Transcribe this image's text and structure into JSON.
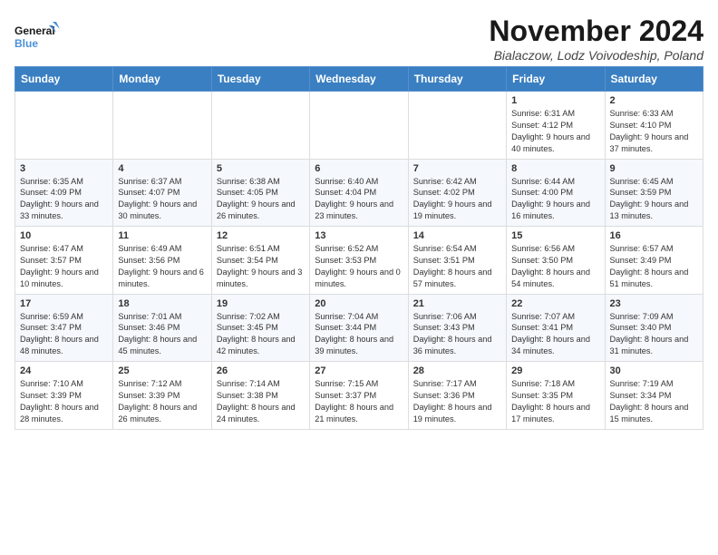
{
  "logo": {
    "line1": "General",
    "line2": "Blue"
  },
  "title": "November 2024",
  "subtitle": "Bialaczow, Lodz Voivodeship, Poland",
  "weekdays": [
    "Sunday",
    "Monday",
    "Tuesday",
    "Wednesday",
    "Thursday",
    "Friday",
    "Saturday"
  ],
  "weeks": [
    [
      {
        "day": "",
        "sunrise": "",
        "sunset": "",
        "daylight": ""
      },
      {
        "day": "",
        "sunrise": "",
        "sunset": "",
        "daylight": ""
      },
      {
        "day": "",
        "sunrise": "",
        "sunset": "",
        "daylight": ""
      },
      {
        "day": "",
        "sunrise": "",
        "sunset": "",
        "daylight": ""
      },
      {
        "day": "",
        "sunrise": "",
        "sunset": "",
        "daylight": ""
      },
      {
        "day": "1",
        "sunrise": "Sunrise: 6:31 AM",
        "sunset": "Sunset: 4:12 PM",
        "daylight": "Daylight: 9 hours and 40 minutes."
      },
      {
        "day": "2",
        "sunrise": "Sunrise: 6:33 AM",
        "sunset": "Sunset: 4:10 PM",
        "daylight": "Daylight: 9 hours and 37 minutes."
      }
    ],
    [
      {
        "day": "3",
        "sunrise": "Sunrise: 6:35 AM",
        "sunset": "Sunset: 4:09 PM",
        "daylight": "Daylight: 9 hours and 33 minutes."
      },
      {
        "day": "4",
        "sunrise": "Sunrise: 6:37 AM",
        "sunset": "Sunset: 4:07 PM",
        "daylight": "Daylight: 9 hours and 30 minutes."
      },
      {
        "day": "5",
        "sunrise": "Sunrise: 6:38 AM",
        "sunset": "Sunset: 4:05 PM",
        "daylight": "Daylight: 9 hours and 26 minutes."
      },
      {
        "day": "6",
        "sunrise": "Sunrise: 6:40 AM",
        "sunset": "Sunset: 4:04 PM",
        "daylight": "Daylight: 9 hours and 23 minutes."
      },
      {
        "day": "7",
        "sunrise": "Sunrise: 6:42 AM",
        "sunset": "Sunset: 4:02 PM",
        "daylight": "Daylight: 9 hours and 19 minutes."
      },
      {
        "day": "8",
        "sunrise": "Sunrise: 6:44 AM",
        "sunset": "Sunset: 4:00 PM",
        "daylight": "Daylight: 9 hours and 16 minutes."
      },
      {
        "day": "9",
        "sunrise": "Sunrise: 6:45 AM",
        "sunset": "Sunset: 3:59 PM",
        "daylight": "Daylight: 9 hours and 13 minutes."
      }
    ],
    [
      {
        "day": "10",
        "sunrise": "Sunrise: 6:47 AM",
        "sunset": "Sunset: 3:57 PM",
        "daylight": "Daylight: 9 hours and 10 minutes."
      },
      {
        "day": "11",
        "sunrise": "Sunrise: 6:49 AM",
        "sunset": "Sunset: 3:56 PM",
        "daylight": "Daylight: 9 hours and 6 minutes."
      },
      {
        "day": "12",
        "sunrise": "Sunrise: 6:51 AM",
        "sunset": "Sunset: 3:54 PM",
        "daylight": "Daylight: 9 hours and 3 minutes."
      },
      {
        "day": "13",
        "sunrise": "Sunrise: 6:52 AM",
        "sunset": "Sunset: 3:53 PM",
        "daylight": "Daylight: 9 hours and 0 minutes."
      },
      {
        "day": "14",
        "sunrise": "Sunrise: 6:54 AM",
        "sunset": "Sunset: 3:51 PM",
        "daylight": "Daylight: 8 hours and 57 minutes."
      },
      {
        "day": "15",
        "sunrise": "Sunrise: 6:56 AM",
        "sunset": "Sunset: 3:50 PM",
        "daylight": "Daylight: 8 hours and 54 minutes."
      },
      {
        "day": "16",
        "sunrise": "Sunrise: 6:57 AM",
        "sunset": "Sunset: 3:49 PM",
        "daylight": "Daylight: 8 hours and 51 minutes."
      }
    ],
    [
      {
        "day": "17",
        "sunrise": "Sunrise: 6:59 AM",
        "sunset": "Sunset: 3:47 PM",
        "daylight": "Daylight: 8 hours and 48 minutes."
      },
      {
        "day": "18",
        "sunrise": "Sunrise: 7:01 AM",
        "sunset": "Sunset: 3:46 PM",
        "daylight": "Daylight: 8 hours and 45 minutes."
      },
      {
        "day": "19",
        "sunrise": "Sunrise: 7:02 AM",
        "sunset": "Sunset: 3:45 PM",
        "daylight": "Daylight: 8 hours and 42 minutes."
      },
      {
        "day": "20",
        "sunrise": "Sunrise: 7:04 AM",
        "sunset": "Sunset: 3:44 PM",
        "daylight": "Daylight: 8 hours and 39 minutes."
      },
      {
        "day": "21",
        "sunrise": "Sunrise: 7:06 AM",
        "sunset": "Sunset: 3:43 PM",
        "daylight": "Daylight: 8 hours and 36 minutes."
      },
      {
        "day": "22",
        "sunrise": "Sunrise: 7:07 AM",
        "sunset": "Sunset: 3:41 PM",
        "daylight": "Daylight: 8 hours and 34 minutes."
      },
      {
        "day": "23",
        "sunrise": "Sunrise: 7:09 AM",
        "sunset": "Sunset: 3:40 PM",
        "daylight": "Daylight: 8 hours and 31 minutes."
      }
    ],
    [
      {
        "day": "24",
        "sunrise": "Sunrise: 7:10 AM",
        "sunset": "Sunset: 3:39 PM",
        "daylight": "Daylight: 8 hours and 28 minutes."
      },
      {
        "day": "25",
        "sunrise": "Sunrise: 7:12 AM",
        "sunset": "Sunset: 3:39 PM",
        "daylight": "Daylight: 8 hours and 26 minutes."
      },
      {
        "day": "26",
        "sunrise": "Sunrise: 7:14 AM",
        "sunset": "Sunset: 3:38 PM",
        "daylight": "Daylight: 8 hours and 24 minutes."
      },
      {
        "day": "27",
        "sunrise": "Sunrise: 7:15 AM",
        "sunset": "Sunset: 3:37 PM",
        "daylight": "Daylight: 8 hours and 21 minutes."
      },
      {
        "day": "28",
        "sunrise": "Sunrise: 7:17 AM",
        "sunset": "Sunset: 3:36 PM",
        "daylight": "Daylight: 8 hours and 19 minutes."
      },
      {
        "day": "29",
        "sunrise": "Sunrise: 7:18 AM",
        "sunset": "Sunset: 3:35 PM",
        "daylight": "Daylight: 8 hours and 17 minutes."
      },
      {
        "day": "30",
        "sunrise": "Sunrise: 7:19 AM",
        "sunset": "Sunset: 3:34 PM",
        "daylight": "Daylight: 8 hours and 15 minutes."
      }
    ]
  ]
}
